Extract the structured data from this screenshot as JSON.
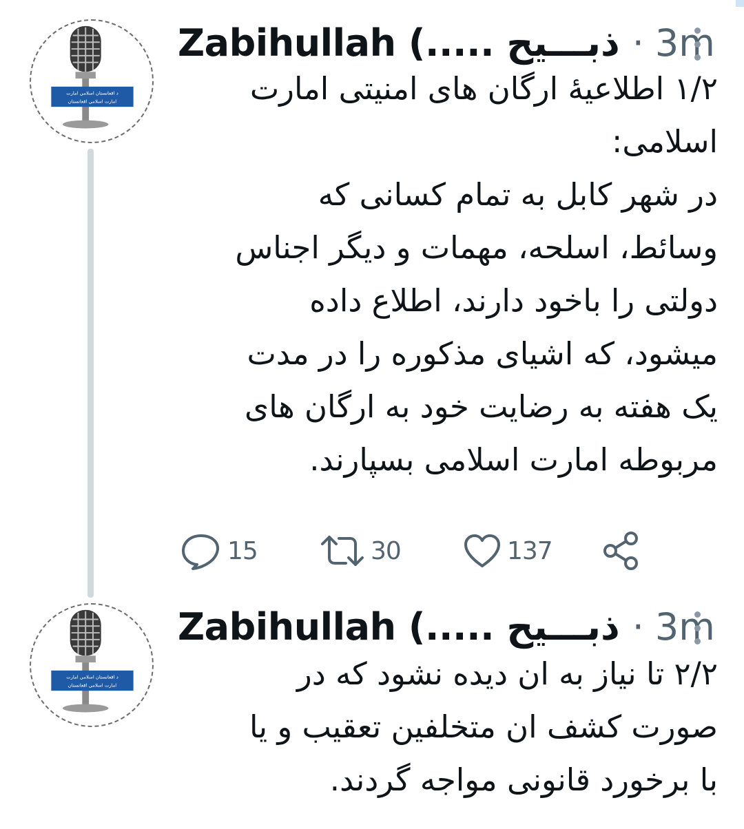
{
  "tweets": [
    {
      "author": "Zabihullah (..... ذبـــیح",
      "separator": "·",
      "time": "3m",
      "avatar_caption_line1": "د افغانستان اسلامي امارت",
      "avatar_caption_line2": "امارت اسلامی افغانستان",
      "body": "۱/۲ اطلاعیهٔ ارگان های امنیتی امارت\nاسلامی:\nدر شهر کابل به تمام کسانی که\nوسائط، اسلحه، مهمات و دیگر اجناس\nدولتی را باخود دارند، اطلاع داده\nمیشود، که اشیای مذکوره را در مدت\nیک هفته به رضایت خود به ارگان های\nمربوطه امارت اسلامی بسپارند.",
      "actions": {
        "replies": "15",
        "retweets": "30",
        "likes": "137"
      },
      "icons": [
        "reply-icon",
        "retweet-icon",
        "like-icon",
        "share-icon",
        "more-icon"
      ]
    },
    {
      "author": "Zabihullah (..... ذبـــیح",
      "separator": "·",
      "time": "3m",
      "avatar_caption_line1": "د افغانستان اسلامي امارت",
      "avatar_caption_line2": "امارت اسلامی افغانستان",
      "body": "۲/۲ تا نیاز به ان دیده نشود که در\nصورت کشف ان متخلفین تعقیب و یا\nبا برخورد قانونی مواجه گردند."
    }
  ],
  "colors": {
    "text": "#0f1419",
    "secondary": "#536471",
    "thread_line": "#cfd9de",
    "banner_blue": "#1f5aa6"
  }
}
